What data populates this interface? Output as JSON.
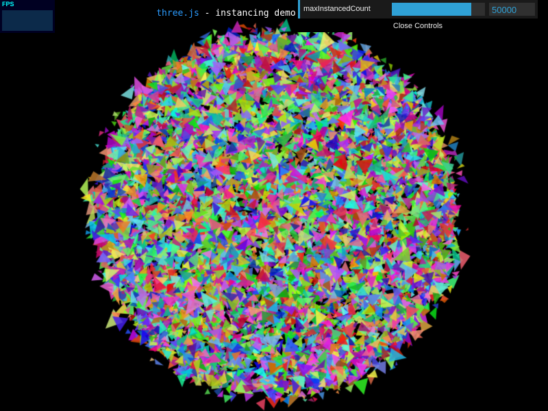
{
  "info": {
    "link_text": "three.js",
    "title_text": " - instancing demo"
  },
  "stats": {
    "label": "FPS"
  },
  "gui": {
    "controller": {
      "name": "maxInstancedCount",
      "value": "50000",
      "fraction": 0.85
    },
    "close_label": "Close Controls",
    "accent_color": "#2fa1d6"
  },
  "scene": {
    "background": "#000000",
    "description_icon": "instanced-triangle-sphere"
  }
}
